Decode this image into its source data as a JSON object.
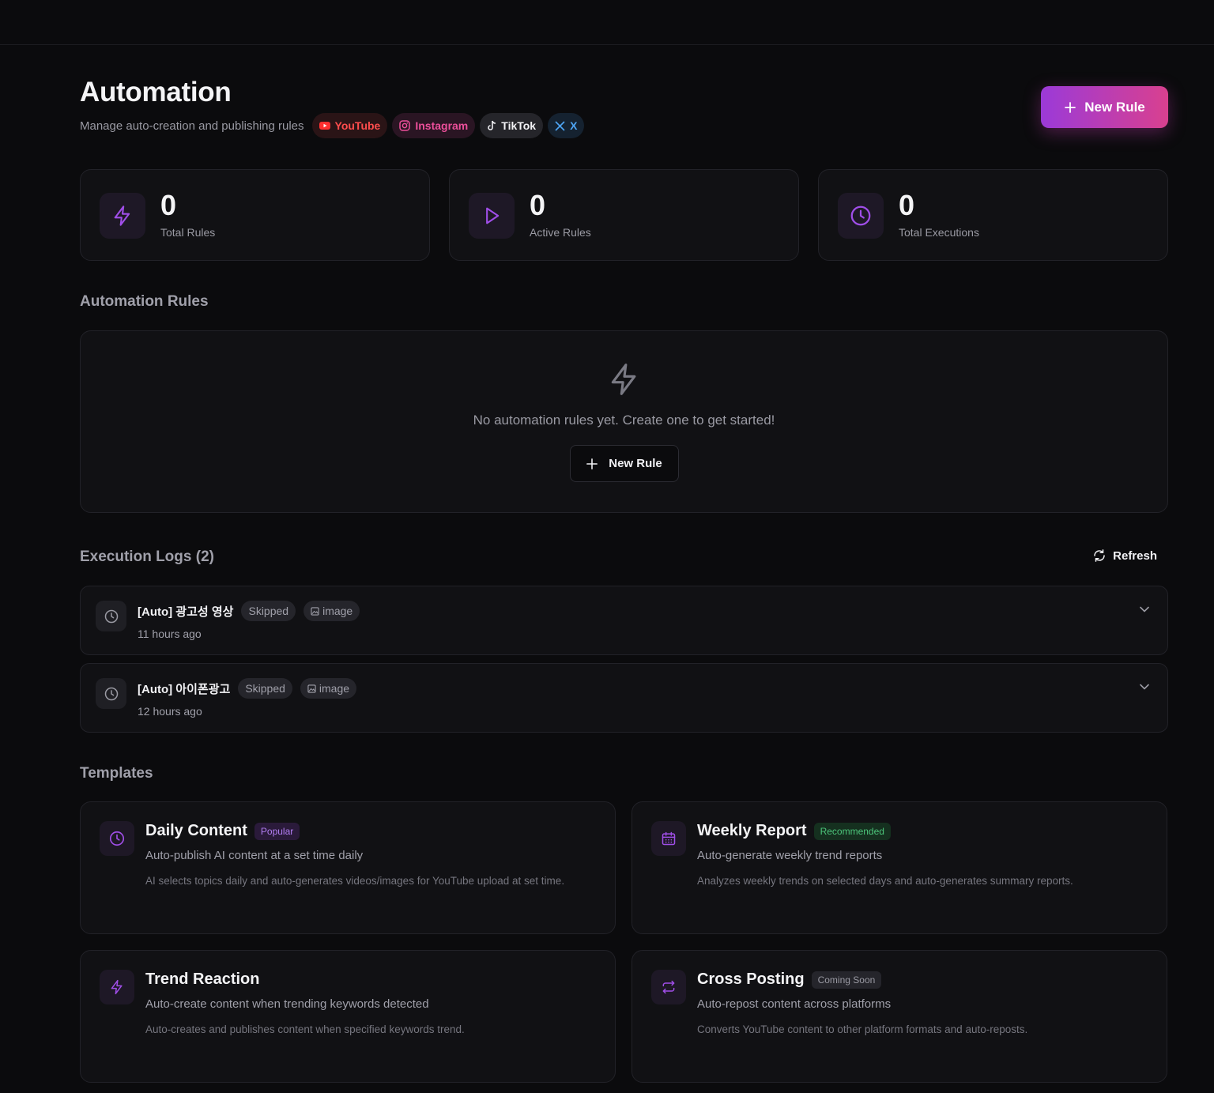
{
  "header": {
    "title": "Automation",
    "subtitle": "Manage auto-creation and publishing rules",
    "platforms": [
      {
        "label": "YouTube",
        "icon": "youtube-icon",
        "color": "#ff4d4d"
      },
      {
        "label": "Instagram",
        "icon": "instagram-icon",
        "color": "#ec4f9a"
      },
      {
        "label": "TikTok",
        "icon": "tiktok-icon",
        "color": "#f2f2f5"
      },
      {
        "label": "X",
        "icon": "x-icon",
        "color": "#4ea6f5"
      }
    ],
    "new_rule_label": "New Rule"
  },
  "stats": [
    {
      "value": "0",
      "label": "Total Rules",
      "icon": "lightning-icon"
    },
    {
      "value": "0",
      "label": "Active Rules",
      "icon": "play-icon"
    },
    {
      "value": "0",
      "label": "Total Executions",
      "icon": "clock-icon"
    }
  ],
  "rules": {
    "title": "Automation Rules",
    "empty_text": "No automation rules yet. Create one to get started!",
    "new_rule_label": "New Rule"
  },
  "logs": {
    "title": "Execution Logs (2)",
    "refresh_label": "Refresh",
    "items": [
      {
        "title": "[Auto] 광고성 영상",
        "status": "Skipped",
        "type": "image",
        "time": "11 hours ago"
      },
      {
        "title": "[Auto] 아이폰광고",
        "status": "Skipped",
        "type": "image",
        "time": "12 hours ago"
      }
    ]
  },
  "templates": {
    "title": "Templates",
    "items": [
      {
        "title": "Daily Content",
        "badge": "Popular",
        "desc": "Auto-publish AI content at a set time daily",
        "detail": "AI selects topics daily and auto-generates videos/images for YouTube upload at set time.",
        "icon": "clock-icon"
      },
      {
        "title": "Weekly Report",
        "badge": "Recommended",
        "desc": "Auto-generate weekly trend reports",
        "detail": "Analyzes weekly trends on selected days and auto-generates summary reports.",
        "icon": "calendar-icon"
      },
      {
        "title": "Trend Reaction",
        "badge": "",
        "desc": "Auto-create content when trending keywords detected",
        "detail": "Auto-creates and publishes content when specified keywords trend.",
        "icon": "lightning-icon"
      },
      {
        "title": "Cross Posting",
        "badge": "Coming Soon",
        "desc": "Auto-repost content across platforms",
        "detail": "Converts YouTube content to other platform formats and auto-reposts.",
        "icon": "repost-icon"
      }
    ]
  },
  "colors": {
    "accent": "#9b3ad8",
    "accent2": "#d9408f",
    "background": "#0b0b0d",
    "card": "#111114"
  }
}
